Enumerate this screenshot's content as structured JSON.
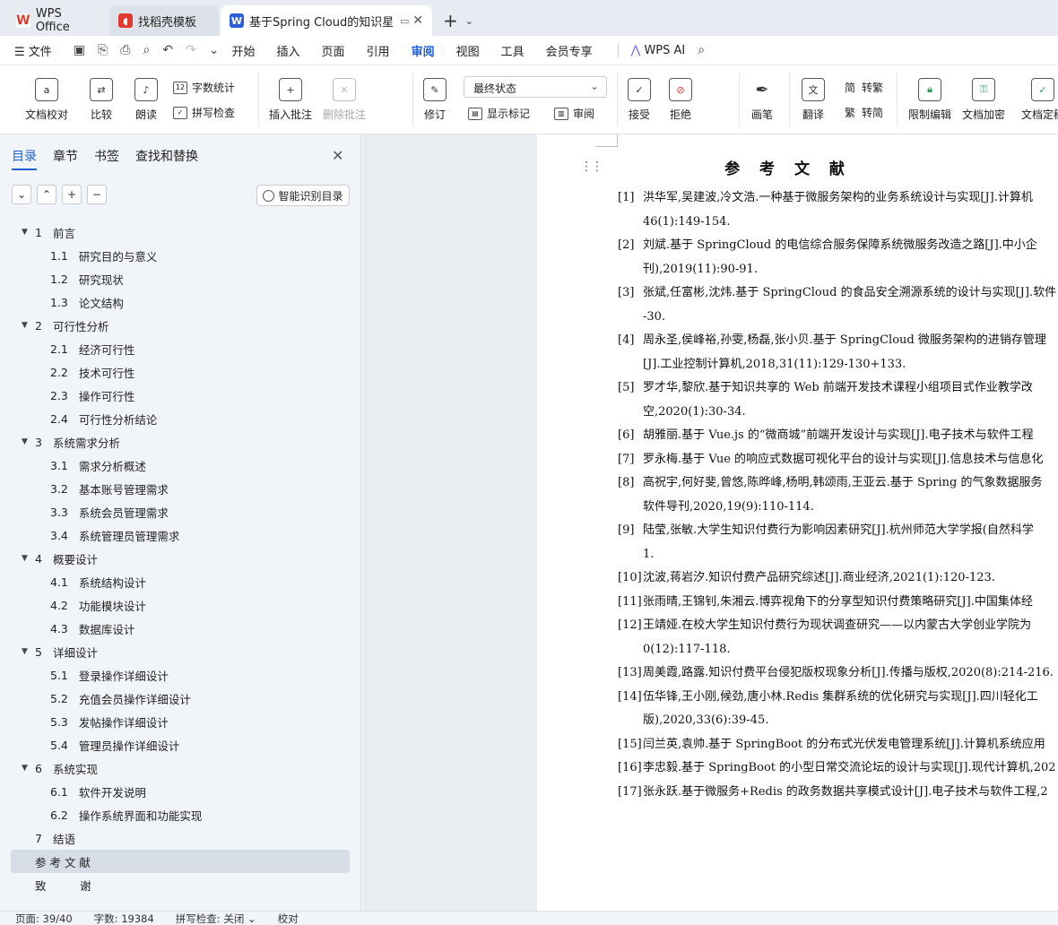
{
  "tabs": [
    {
      "label": "WPS Office",
      "icon": "wps-logo-icon"
    },
    {
      "label": "找稻壳模板",
      "icon": "docer-logo-icon"
    },
    {
      "label": "基于Spring Cloud的知识星球",
      "icon": "word-doc-icon"
    }
  ],
  "menu": {
    "file": "文件",
    "items": [
      "开始",
      "插入",
      "页面",
      "引用",
      "审阅",
      "视图",
      "工具",
      "会员专享"
    ],
    "active": "审阅",
    "ai": "WPS AI"
  },
  "ribbon": {
    "doc_check": "文档校对",
    "compare": "比较",
    "read_aloud": "朗读",
    "word_count": "字数统计",
    "spell_check": "拼写检查",
    "insert_comment": "插入批注",
    "delete_comment": "删除批注",
    "track": "修订",
    "status_select": "最终状态",
    "show_markup": "显示标记",
    "review": "审阅",
    "accept": "接受",
    "reject": "拒绝",
    "pen": "画笔",
    "translate": "翻译",
    "to_traditional": "转繁",
    "to_simplified": "转简",
    "restrict_edit": "限制编辑",
    "encrypt": "文档加密",
    "finalize": "文档定稿"
  },
  "nav": {
    "tabs": [
      "目录",
      "章节",
      "书签",
      "查找和替换"
    ],
    "smart_button": "智能识别目录",
    "toc": [
      {
        "level": 1,
        "num": "1",
        "text": "前言"
      },
      {
        "level": 2,
        "num": "1.1",
        "text": "研究目的与意义"
      },
      {
        "level": 2,
        "num": "1.2",
        "text": "研究现状"
      },
      {
        "level": 2,
        "num": "1.3",
        "text": "论文结构"
      },
      {
        "level": 1,
        "num": "2",
        "text": "可行性分析"
      },
      {
        "level": 2,
        "num": "2.1",
        "text": "经济可行性"
      },
      {
        "level": 2,
        "num": "2.2",
        "text": "技术可行性"
      },
      {
        "level": 2,
        "num": "2.3",
        "text": "操作可行性"
      },
      {
        "level": 2,
        "num": "2.4",
        "text": "可行性分析结论"
      },
      {
        "level": 1,
        "num": "3",
        "text": "系统需求分析"
      },
      {
        "level": 2,
        "num": "3.1",
        "text": "需求分析概述"
      },
      {
        "level": 2,
        "num": "3.2",
        "text": "基本账号管理需求"
      },
      {
        "level": 2,
        "num": "3.3",
        "text": "系统会员管理需求"
      },
      {
        "level": 2,
        "num": "3.4",
        "text": "系统管理员管理需求"
      },
      {
        "level": 1,
        "num": "4",
        "text": "概要设计"
      },
      {
        "level": 2,
        "num": "4.1",
        "text": "系统结构设计"
      },
      {
        "level": 2,
        "num": "4.2",
        "text": "功能模块设计"
      },
      {
        "level": 2,
        "num": "4.3",
        "text": "数据库设计"
      },
      {
        "level": 1,
        "num": "5",
        "text": "详细设计"
      },
      {
        "level": 2,
        "num": "5.1",
        "text": "登录操作详细设计"
      },
      {
        "level": 2,
        "num": "5.2",
        "text": "充值会员操作详细设计"
      },
      {
        "level": 2,
        "num": "5.3",
        "text": "发帖操作详细设计"
      },
      {
        "level": 2,
        "num": "5.4",
        "text": "管理员操作详细设计"
      },
      {
        "level": 1,
        "num": "6",
        "text": "系统实现"
      },
      {
        "level": 2,
        "num": "6.1",
        "text": "软件开发说明"
      },
      {
        "level": 2,
        "num": "6.2",
        "text": "操作系统界面和功能实现"
      },
      {
        "level": 0,
        "num": "7",
        "text": "结语"
      },
      {
        "level": 0,
        "num": "",
        "text": "参 考 文 献",
        "selected": true
      },
      {
        "level": 0,
        "num": "",
        "text": "致　　　谢"
      }
    ]
  },
  "document": {
    "title": "参 考 文 献",
    "references": [
      {
        "n": "[1]",
        "lines": [
          "洪华军,吴建波,冷文浩.一种基于微服务架构的业务系统设计与实现[J].计算机",
          "46(1):149-154."
        ]
      },
      {
        "n": "[2]",
        "lines": [
          "刘斌.基于 SpringCloud 的电信综合服务保障系统微服务改造之路[J].中小企",
          "刊),2019(11):90-91."
        ]
      },
      {
        "n": "[3]",
        "lines": [
          "张斌,任富彬,沈炜.基于 SpringCloud 的食品安全溯源系统的设计与实现[J].软件",
          "-30."
        ]
      },
      {
        "n": "[4]",
        "lines": [
          "周永圣,侯峰裕,孙雯,杨磊,张小贝.基于 SpringCloud 微服务架构的进销存管理",
          "[J].工业控制计算机,2018,31(11):129-130+133."
        ]
      },
      {
        "n": "[5]",
        "lines": [
          "罗才华,黎欣.基于知识共享的 Web 前端开发技术课程小组项目式作业教学改",
          "空,2020(1):30-34."
        ]
      },
      {
        "n": "[6]",
        "lines": [
          "胡雅丽.基于 Vue.js 的“微商城”前端开发设计与实现[J].电子技术与软件工程"
        ]
      },
      {
        "n": "[7]",
        "lines": [
          "罗永梅.基于 Vue 的响应式数据可视化平台的设计与实现[J].信息技术与信息化"
        ]
      },
      {
        "n": "[8]",
        "lines": [
          "高祝宇,何好斐,曾悠,陈晔峰,杨明,韩颂雨,王亚云.基于 Spring 的气象数据服务",
          "软件导刊,2020,19(9):110-114."
        ]
      },
      {
        "n": "[9]",
        "lines": [
          "陆莹,张敏.大学生知识付费行为影响因素研究[J].杭州师范大学学报(自然科学",
          "1."
        ]
      },
      {
        "n": "[10]",
        "lines": [
          "沈波,蒋岩汐.知识付费产品研究综述[J].商业经济,2021(1):120-123."
        ]
      },
      {
        "n": "[11]",
        "lines": [
          "张雨晴,王锦钊,朱湘云.博弈视角下的分享型知识付费策略研究[J].中国集体经"
        ]
      },
      {
        "n": "[12]",
        "lines": [
          "王靖娅.在校大学生知识付费行为现状调查研究——以内蒙古大学创业学院为",
          "0(12):117-118."
        ]
      },
      {
        "n": "[13]",
        "lines": [
          "周美霞,路露.知识付费平台侵犯版权现象分析[J].传播与版权,2020(8):214-216."
        ]
      },
      {
        "n": "[14]",
        "lines": [
          "伍华锋,王小刚,候劲,唐小林.Redis 集群系统的优化研究与实现[J].四川轻化工",
          "版),2020,33(6):39-45."
        ]
      },
      {
        "n": "[15]",
        "lines": [
          "闫兰英,袁帅.基于 SpringBoot 的分布式光伏发电管理系统[J].计算机系统应用"
        ]
      },
      {
        "n": "[16]",
        "lines": [
          "李忠毅.基于 SpringBoot 的小型日常交流论坛的设计与实现[J].现代计算机,202"
        ]
      },
      {
        "n": "[17]",
        "lines": [
          "张永跃.基于微服务+Redis 的政务数据共享模式设计[J].电子技术与软件工程,2"
        ]
      }
    ]
  },
  "status": {
    "page": "页面: 39/40",
    "words": "字数: 19384",
    "spell": "拼写检查: 关闭 ⌄",
    "proof": "校对"
  },
  "colors": {
    "accent": "#1f5fd6",
    "wps_red": "#e23a2e",
    "word_blue": "#2b5fd9"
  }
}
